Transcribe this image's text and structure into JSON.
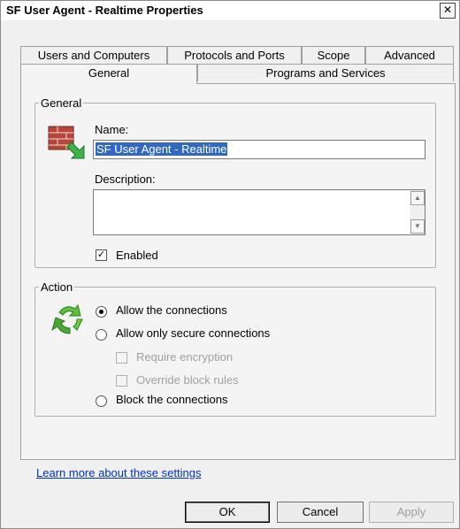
{
  "window": {
    "title": "SF User Agent - Realtime Properties",
    "close_glyph": "✕"
  },
  "tabs_row1": [
    "Users and Computers",
    "Protocols and Ports",
    "Scope",
    "Advanced"
  ],
  "tabs_row2": [
    "General",
    "Programs and Services"
  ],
  "general_group": {
    "legend": "General",
    "name_label": "Name:",
    "name_value": "SF User Agent - Realtime",
    "description_label": "Description:",
    "description_value": "",
    "enabled_label": "Enabled",
    "enabled_checked": true,
    "icon": "firewall-brick-icon"
  },
  "action_group": {
    "legend": "Action",
    "icon": "recycle-arrows-icon",
    "options": [
      {
        "label": "Allow the connections",
        "checked": true
      },
      {
        "label": "Allow only secure connections",
        "checked": false
      },
      {
        "label": "Block the connections",
        "checked": false
      }
    ],
    "require_encryption": "Require encryption",
    "override_block_rules": "Override block rules"
  },
  "learn_more": "Learn more about these settings",
  "buttons": {
    "ok": "OK",
    "cancel": "Cancel",
    "apply": "Apply"
  }
}
